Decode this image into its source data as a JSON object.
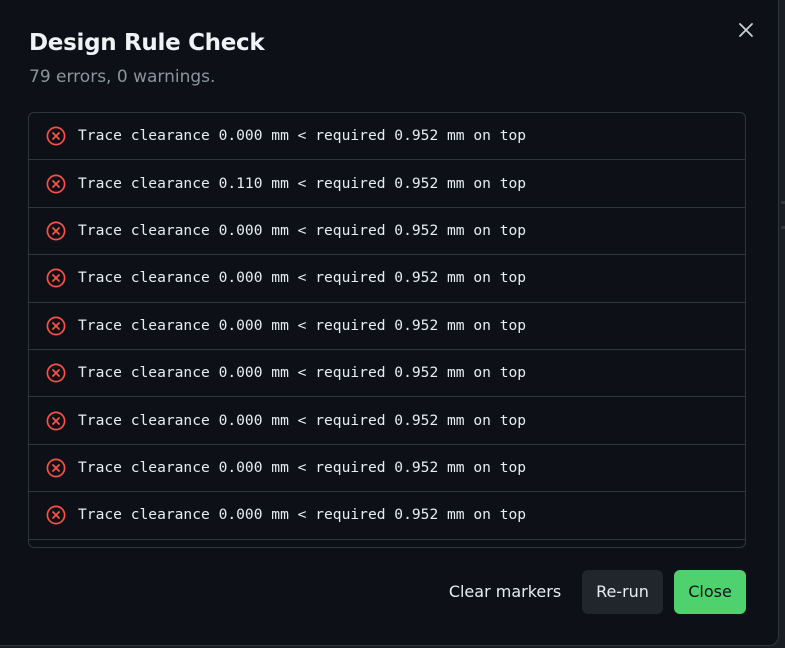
{
  "dialog": {
    "title": "Design Rule Check",
    "summary": "79 errors, 0 warnings."
  },
  "violations": [
    {
      "severity": "error",
      "message": "Trace clearance 0.000 mm < required 0.952 mm on top"
    },
    {
      "severity": "error",
      "message": "Trace clearance 0.110 mm < required 0.952 mm on top"
    },
    {
      "severity": "error",
      "message": "Trace clearance 0.000 mm < required 0.952 mm on top"
    },
    {
      "severity": "error",
      "message": "Trace clearance 0.000 mm < required 0.952 mm on top"
    },
    {
      "severity": "error",
      "message": "Trace clearance 0.000 mm < required 0.952 mm on top"
    },
    {
      "severity": "error",
      "message": "Trace clearance 0.000 mm < required 0.952 mm on top"
    },
    {
      "severity": "error",
      "message": "Trace clearance 0.000 mm < required 0.952 mm on top"
    },
    {
      "severity": "error",
      "message": "Trace clearance 0.000 mm < required 0.952 mm on top"
    },
    {
      "severity": "error",
      "message": "Trace clearance 0.000 mm < required 0.952 mm on top"
    }
  ],
  "actions": {
    "clear_markers": "Clear markers",
    "rerun": "Re-run",
    "close": "Close"
  },
  "icons": {
    "close": "close-icon",
    "error": "error-circle-icon"
  },
  "colors": {
    "background": "#0d1117",
    "border": "#30363d",
    "error": "#f85149",
    "primary": "#4fd16d",
    "secondary_button": "#21262d",
    "text": "#e6edf3",
    "muted": "#8b949e"
  }
}
